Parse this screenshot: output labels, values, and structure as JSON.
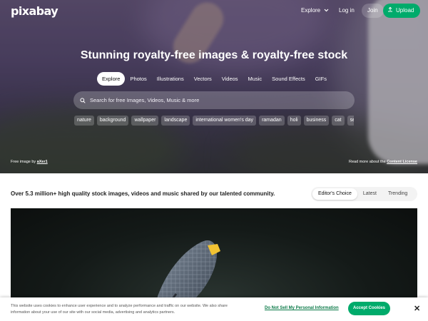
{
  "header": {
    "logo": "pixabay",
    "explore_label": "Explore",
    "login_label": "Log in",
    "join_label": "Join",
    "upload_label": "Upload"
  },
  "hero": {
    "headline": "Stunning royalty-free images & royalty-free stock",
    "tabs": [
      {
        "label": "Explore",
        "active": true
      },
      {
        "label": "Photos"
      },
      {
        "label": "Illustrations"
      },
      {
        "label": "Vectors"
      },
      {
        "label": "Videos"
      },
      {
        "label": "Music"
      },
      {
        "label": "Sound Effects"
      },
      {
        "label": "GIFs"
      }
    ],
    "search_placeholder": "Search for free Images, Videos, Music & more",
    "tags": [
      "nature",
      "background",
      "wallpaper",
      "landscape",
      "international women's day",
      "ramadan",
      "holi",
      "business",
      "cat",
      "se"
    ],
    "credit_prefix": "Free image by",
    "credit_author": "aXer1",
    "license_prefix": "Read more about the",
    "license_link": "Content License"
  },
  "main": {
    "tagline": "Over 5.3 million+ high quality stock images, videos and music shared by our talented community.",
    "sort_options": [
      {
        "label": "Editor's Choice",
        "active": true
      },
      {
        "label": "Latest"
      },
      {
        "label": "Trending"
      }
    ]
  },
  "cookie": {
    "text": "This website uses cookies to enhance user experience and to analyze performance and traffic on our website. We also share information about your use of our site with our social media, advertising and analytics partners.",
    "link_label": "Do Not Sell My Personal Information",
    "accept_label": "Accept Cookies",
    "close_label": "✕"
  },
  "colors": {
    "brand_green": "#00ab6b"
  }
}
